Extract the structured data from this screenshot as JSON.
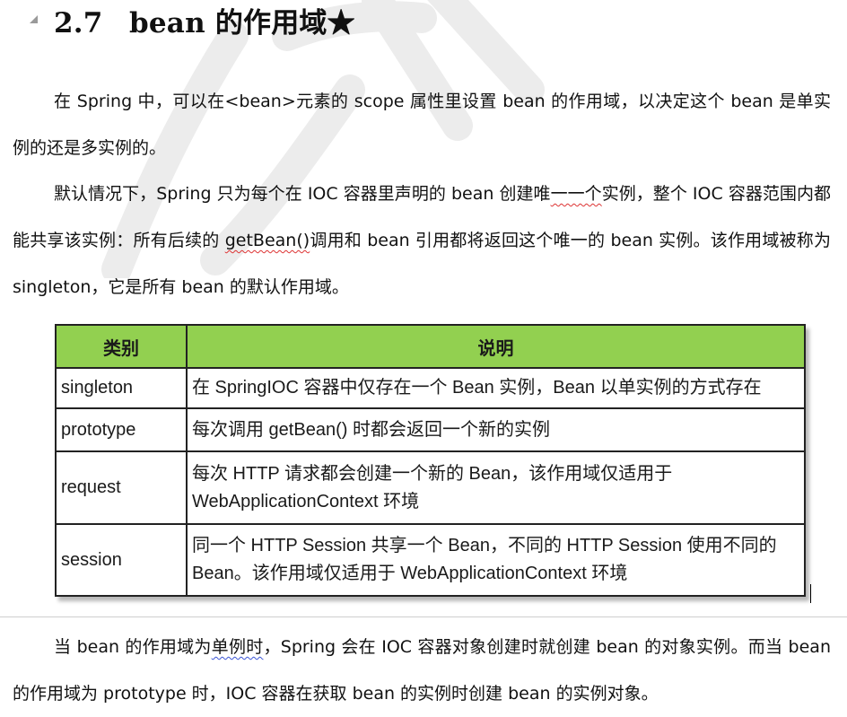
{
  "heading": {
    "number": "2.7",
    "title": "bean 的作用域★"
  },
  "paragraph1": {
    "text": "在 Spring 中，可以在<bean>元素的 scope 属性里设置 bean 的作用域，以决定这个 bean 是单实例的还是多实例的。"
  },
  "paragraph2": {
    "part1": "默认情况下，Spring 只为每个在 IOC 容器里声明的 bean 创建唯",
    "squiggle1": "一一个",
    "part2": "实例，整个 IOC 容器范围内都能共享该实例：所有后续的 ",
    "squiggle2": "getBean()",
    "part3": "调用和 bean 引用都将返回这个唯一的 bean 实例。该作用域被称为 singleton，它是所有 bean 的默认作用域。"
  },
  "table": {
    "headers": [
      "类别",
      "说明"
    ],
    "rows": [
      {
        "type": "singleton",
        "desc": "在 SpringIOC 容器中仅存在一个 Bean 实例，Bean 以单实例的方式存在"
      },
      {
        "type": "prototype",
        "desc": "每次调用 getBean() 时都会返回一个新的实例"
      },
      {
        "type": "request",
        "desc": "每次 HTTP 请求都会创建一个新的 Bean，该作用域仅适用于 WebApplicationContext 环境"
      },
      {
        "type": "session",
        "desc": "同一个 HTTP Session 共享一个 Bean，不同的 HTTP Session 使用不同的 Bean。该作用域仅适用于 WebApplicationContext 环境"
      }
    ],
    "header_color": "#92d050"
  },
  "paragraph3": {
    "part1": "当 bean 的作用域为",
    "squiggle": "单例时",
    "part2": "，Spring 会在 IOC 容器对象创建时就创建 bean 的对象实例。而当 bean 的作用域为 prototype 时，IOC 容器在获取 bean 的实例时创建 bean 的实例对象。"
  },
  "icons": {
    "collapse": "collapse-triangle-icon",
    "watermark": "watermark-logo-icon"
  }
}
